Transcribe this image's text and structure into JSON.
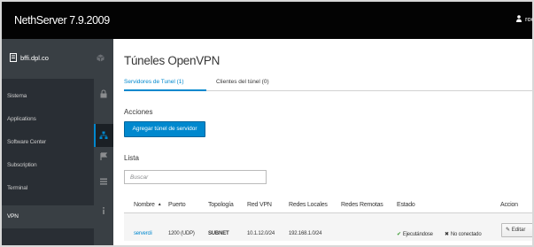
{
  "app": {
    "brand": "NethServer 7.9.2009",
    "user": "roo"
  },
  "sidebar": {
    "host": "bffi.dpl.co",
    "items": [
      {
        "label": "Sistema"
      },
      {
        "label": "Applications"
      },
      {
        "label": "Software Center"
      },
      {
        "label": "Subscription"
      },
      {
        "label": "Terminal"
      },
      {
        "label": "VPN"
      }
    ]
  },
  "page": {
    "title": "Túneles OpenVPN",
    "tabs": [
      {
        "label": "Servidores de Tunel (1)"
      },
      {
        "label": "Clientes del túnel (0)"
      }
    ],
    "actions_label": "Acciones",
    "add_button": "Agregar túnel de servidor",
    "list_label": "Lista",
    "search_placeholder": "Buscar"
  },
  "table": {
    "columns": [
      "Nombre",
      "Puerto",
      "Topología",
      "Red VPN",
      "Redes Locales",
      "Redes Remotas",
      "Estado",
      "Accion"
    ],
    "rows": [
      {
        "name": "servercli",
        "port": "1200 (UDP)",
        "topology": "SUBNET",
        "vpn_network": "10.1.12.0/24",
        "local_networks": "192.168.1.0/24",
        "remote_networks": "",
        "status_running": "Ejecutándose",
        "status_connection": "No conectado",
        "edit_label": "Editar"
      }
    ]
  },
  "colors": {
    "accent": "#0088ce",
    "masthead": "#030303",
    "sidebar": "#292e34",
    "success": "#3f9c35"
  },
  "icons": {
    "user": "user-icon",
    "host": "server-icon",
    "rail": [
      "cube-icon",
      "lock-icon",
      "network-icon",
      "flag-icon",
      "list-icon",
      "info-icon"
    ],
    "edit": "pencil-icon",
    "sort": "sort-asc-icon"
  }
}
